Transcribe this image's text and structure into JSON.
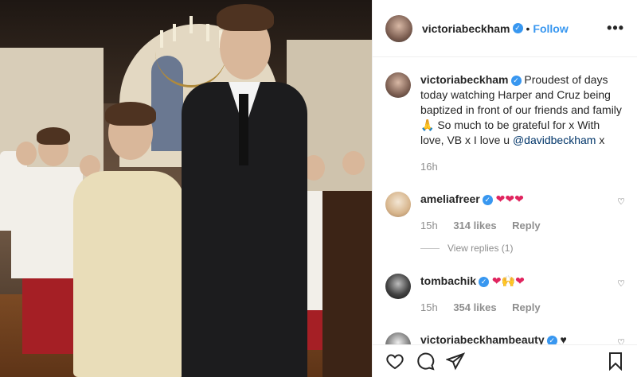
{
  "post": {
    "author": "victoriabeckham",
    "follow_label": "Follow",
    "more_label": "•••",
    "caption": {
      "username": "victoriabeckham",
      "text": "Proudest of days today watching Harper and Cruz being baptized in front of our friends and family 🙏 So much to be grateful for x With love, VB x I love u",
      "mention": "@davidbeckham",
      "suffix": " x",
      "time": "16h"
    },
    "comments": [
      {
        "username": "ameliafreer",
        "text": "❤❤❤",
        "time": "15h",
        "likes": "314 likes",
        "reply": "Reply",
        "view_replies": "View replies (1)"
      },
      {
        "username": "tombachik",
        "text": "❤🙌❤",
        "time": "15h",
        "likes": "354 likes",
        "reply": "Reply"
      },
      {
        "username": "victoriabeckhambeauty",
        "text": "♥"
      }
    ]
  },
  "icons": {
    "verified": "verified-badge-icon",
    "heart": "heart-icon",
    "comment": "comment-icon",
    "share": "share-icon",
    "bookmark": "bookmark-icon",
    "more": "more-options-icon"
  },
  "colors": {
    "accent": "#3897f0",
    "meta": "#8e8e8e",
    "text": "#262626"
  }
}
